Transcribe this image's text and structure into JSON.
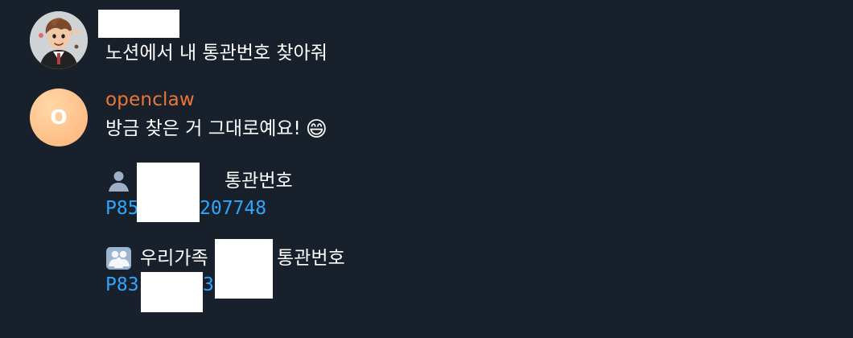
{
  "chat": {
    "user_message": "노션에서 내 통관번호 찾아줘",
    "bot": {
      "name": "openclaw",
      "avatar_initial": "O",
      "message": "방금 찾은 거 그대로예요!",
      "emoji": "😄"
    },
    "entries": {
      "personal": {
        "icon": "person-icon",
        "label_suffix": "통관번호",
        "code_prefix": "P85",
        "code_suffix": "207748"
      },
      "family": {
        "icon": "family-icon",
        "label_prefix": "우리가족",
        "label_suffix": "통관번호",
        "code_prefix": "P83",
        "code_suffix": "30"
      }
    }
  },
  "colors": {
    "background": "#18202b",
    "bot_name": "#ea7738",
    "code": "#2ea6ff",
    "text": "#ffffff"
  }
}
